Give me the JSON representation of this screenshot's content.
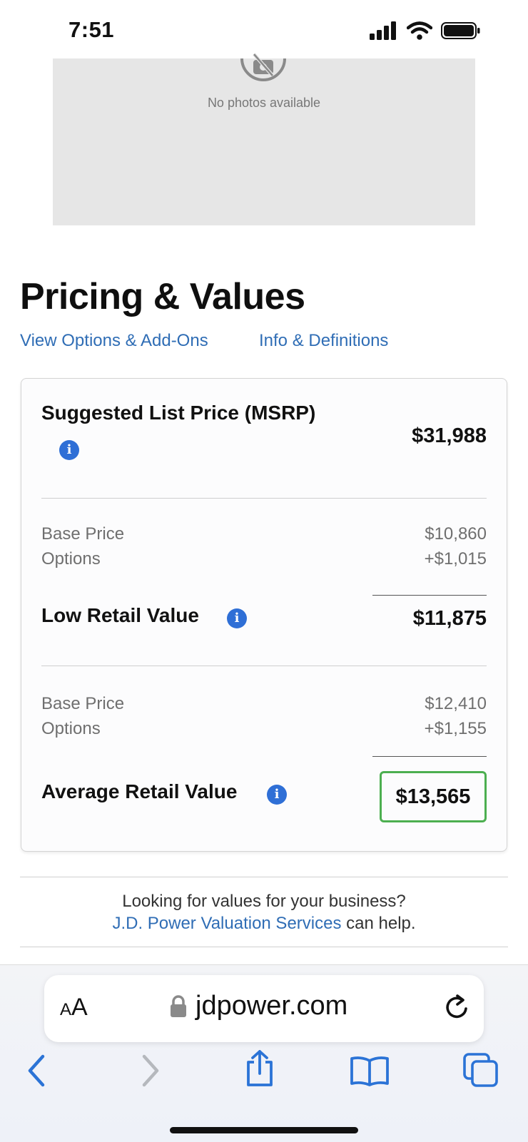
{
  "status_bar": {
    "time": "7:51"
  },
  "photo": {
    "empty_text": "No photos available",
    "icon": "no-photo-icon"
  },
  "page": {
    "title": "Pricing & Values"
  },
  "links": {
    "options": "View Options & Add-Ons",
    "info": "Info & Definitions"
  },
  "pricing": {
    "msrp": {
      "label": "Suggested List Price (MSRP)",
      "value": "$31,988"
    },
    "low": {
      "base_label": "Base Price",
      "base_value": "$10,860",
      "options_label": "Options",
      "options_value": "+$1,015",
      "label": "Low Retail Value",
      "value": "$11,875"
    },
    "average": {
      "base_label": "Base Price",
      "base_value": "$12,410",
      "options_label": "Options",
      "options_value": "+$1,155",
      "label": "Average Retail Value",
      "value": "$13,565"
    },
    "info_glyph": "i"
  },
  "promo": {
    "line1": "Looking for values for your business?",
    "link": "J.D. Power Valuation Services",
    "suffix": " can help."
  },
  "browser": {
    "text_size_small": "A",
    "text_size_large": "A",
    "url": "jdpower.com"
  },
  "colors": {
    "link": "#2f6db5",
    "info": "#2f6fd6",
    "highlight_border": "#4caf50",
    "toolbar_icon": "#2b73d6"
  }
}
